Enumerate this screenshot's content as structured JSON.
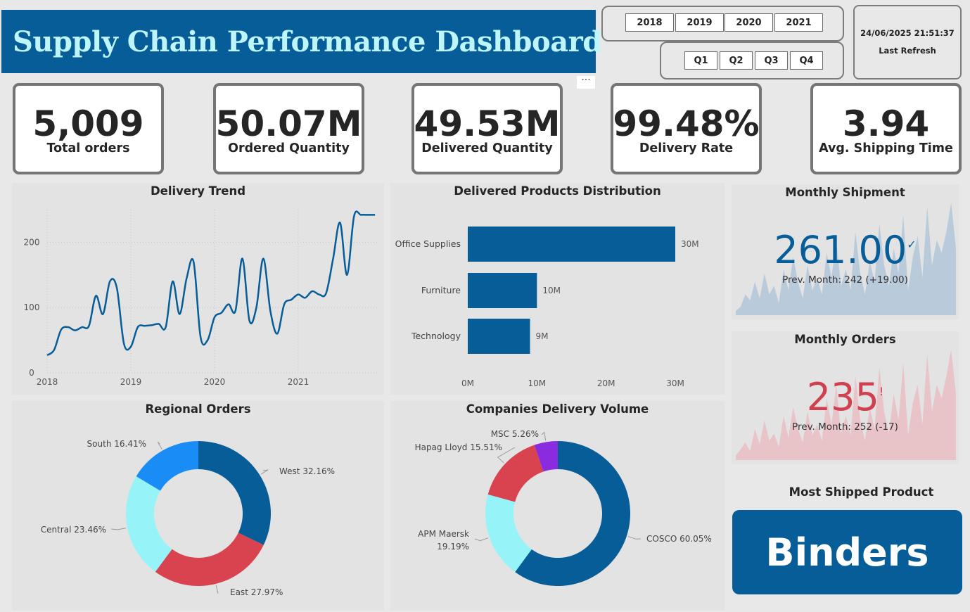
{
  "header": {
    "title": "Supply Chain Performance Dashboard",
    "more_label": "···"
  },
  "slicers": {
    "years": [
      "2018",
      "2019",
      "2020",
      "2021"
    ],
    "quarters": [
      "Q1",
      "Q2",
      "Q3",
      "Q4"
    ]
  },
  "refresh": {
    "timestamp": "24/06/2025 21:51:37",
    "label": "Last Refresh"
  },
  "kpis": [
    {
      "value": "5,009",
      "label": "Total orders"
    },
    {
      "value": "50.07M",
      "label": "Ordered Quantity"
    },
    {
      "value": "49.53M",
      "label": "Delivered Quantity"
    },
    {
      "value": "99.48%",
      "label": "Delivery Rate"
    },
    {
      "value": "3.94",
      "label": "Avg. Shipping Time"
    }
  ],
  "monthly_shipment": {
    "title": "Monthly Shipment",
    "value": "261.00",
    "prev": "Prev. Month: 242 (+19.00)",
    "status_icon": "check-icon",
    "color": "#065d98",
    "area_color": "#b9cbdb"
  },
  "monthly_orders": {
    "title": "Monthly Orders",
    "value": "235",
    "prev": "Prev. Month: 252 (-17)",
    "status_icon": "exclamation-icon",
    "color": "#d0404f",
    "area_color": "#e8c3c8"
  },
  "most_shipped": {
    "title": "Most Shipped Product",
    "value": "Binders"
  },
  "colors": {
    "primary": "#065d98",
    "title_text": "#bdf5fa",
    "red": "#d9434f",
    "cyan": "#96f4f8",
    "light_blue": "#1a8cf5",
    "purple": "#8b2be0"
  },
  "chart_data": [
    {
      "id": "delivery_trend",
      "type": "line",
      "title": "Delivery Trend",
      "xlabel": "",
      "ylabel": "",
      "x_ticks": [
        "2018",
        "2019",
        "2020",
        "2021"
      ],
      "y_ticks": [
        0,
        100,
        200
      ],
      "ylim": [
        0,
        250
      ],
      "x": [
        2018.0,
        2018.083,
        2018.167,
        2018.25,
        2018.333,
        2018.417,
        2018.5,
        2018.583,
        2018.667,
        2018.75,
        2018.833,
        2018.917,
        2019.0,
        2019.083,
        2019.167,
        2019.25,
        2019.333,
        2019.417,
        2019.5,
        2019.583,
        2019.667,
        2019.75,
        2019.833,
        2019.917,
        2020.0,
        2020.083,
        2020.167,
        2020.25,
        2020.333,
        2020.417,
        2020.5,
        2020.583,
        2020.667,
        2020.75,
        2020.833,
        2020.917,
        2021.0,
        2021.083,
        2021.167,
        2021.25,
        2021.333,
        2021.417,
        2021.5,
        2021.583,
        2021.667,
        2021.75,
        2021.833,
        2021.917
      ],
      "values": [
        27,
        35,
        66,
        70,
        65,
        70,
        72,
        118,
        90,
        140,
        130,
        45,
        40,
        70,
        72,
        73,
        75,
        70,
        140,
        90,
        145,
        170,
        55,
        50,
        85,
        92,
        105,
        95,
        175,
        80,
        100,
        175,
        95,
        60,
        105,
        112,
        120,
        115,
        125,
        120,
        122,
        175,
        230,
        150,
        240,
        242,
        242,
        242
      ],
      "grid": true
    },
    {
      "id": "delivered_products",
      "type": "bar",
      "orientation": "horizontal",
      "title": "Delivered Products Distribution",
      "categories": [
        "Office Supplies",
        "Furniture",
        "Technology"
      ],
      "values": [
        30,
        10,
        9
      ],
      "data_labels": [
        "30M",
        "10M",
        "9M"
      ],
      "x_ticks": [
        "0M",
        "10M",
        "20M",
        "30M"
      ],
      "xlim": [
        0,
        30
      ],
      "color": "#065d98"
    },
    {
      "id": "regional_orders",
      "type": "pie",
      "style": "donut",
      "title": "Regional Orders",
      "slices": [
        {
          "label": "West 32.16%",
          "value": 32.16,
          "color": "#065d98"
        },
        {
          "label": "East 27.97%",
          "value": 27.97,
          "color": "#d9434f"
        },
        {
          "label": "Central 23.46%",
          "value": 23.46,
          "color": "#96f4f8"
        },
        {
          "label": "South 16.41%",
          "value": 16.41,
          "color": "#1a8cf5"
        }
      ]
    },
    {
      "id": "companies_delivery",
      "type": "pie",
      "style": "donut",
      "title": "Companies Delivery Volume",
      "slices": [
        {
          "label": "COSCO 60.05%",
          "value": 60.05,
          "color": "#065d98"
        },
        {
          "label": "APM Maersk 19.19%",
          "value": 19.19,
          "color": "#96f4f8"
        },
        {
          "label": "Hapag Lloyd 15.51%",
          "value": 15.51,
          "color": "#d9434f"
        },
        {
          "label": "MSC 5.26%",
          "value": 5.26,
          "color": "#8b2be0"
        }
      ]
    },
    {
      "id": "monthly_shipment_spark",
      "type": "area",
      "values": [
        5,
        10,
        25,
        18,
        40,
        20,
        50,
        25,
        35,
        15,
        55,
        30,
        70,
        40,
        20,
        60,
        30,
        45,
        25,
        75,
        45,
        90,
        35,
        55,
        30,
        100,
        50,
        25,
        65,
        40,
        110,
        60,
        35,
        80,
        50,
        120,
        30,
        70,
        95,
        45,
        130,
        60,
        90,
        75,
        100,
        135,
        80
      ]
    },
    {
      "id": "monthly_orders_spark",
      "type": "area",
      "values": [
        5,
        12,
        20,
        10,
        35,
        18,
        45,
        22,
        30,
        15,
        50,
        25,
        60,
        35,
        20,
        55,
        28,
        40,
        22,
        70,
        40,
        85,
        30,
        50,
        28,
        95,
        45,
        22,
        60,
        35,
        105,
        55,
        30,
        75,
        45,
        110,
        28,
        65,
        85,
        40,
        120,
        55,
        85,
        70,
        95,
        125,
        75
      ]
    }
  ]
}
